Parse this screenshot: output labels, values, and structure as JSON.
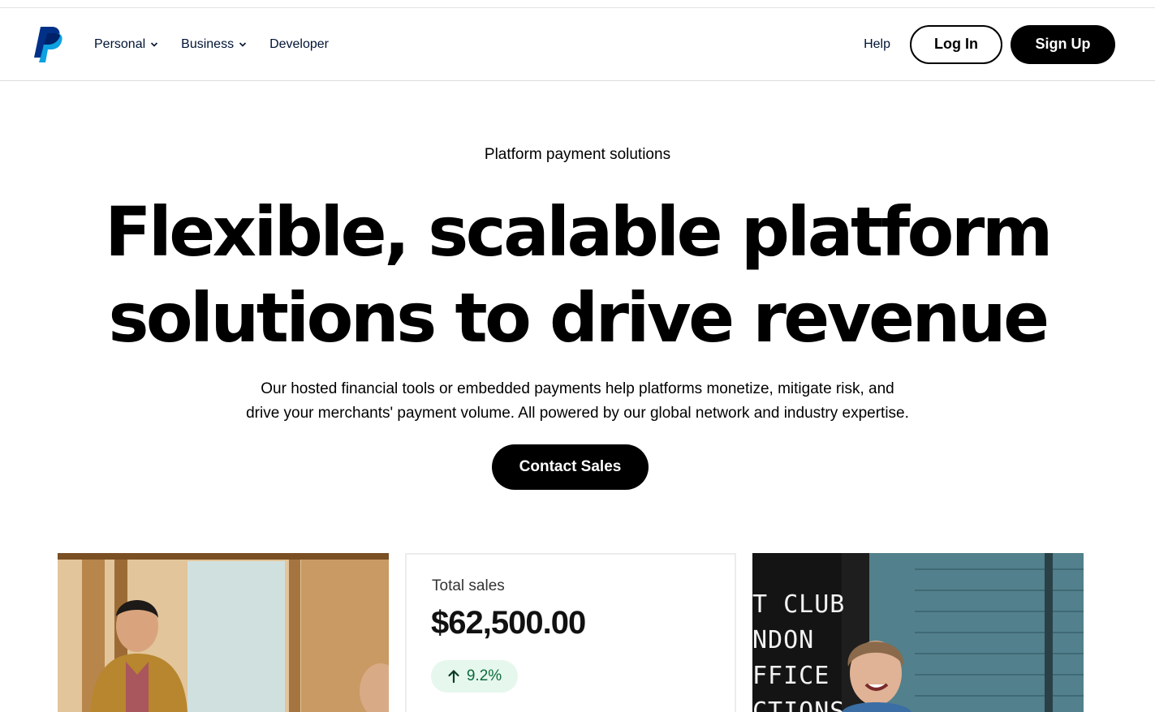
{
  "header": {
    "logo_alt": "PayPal",
    "nav": [
      {
        "label": "Personal",
        "has_dropdown": true
      },
      {
        "label": "Business",
        "has_dropdown": true
      },
      {
        "label": "Developer",
        "has_dropdown": false
      }
    ],
    "help_label": "Help",
    "login_label": "Log In",
    "signup_label": "Sign Up"
  },
  "hero": {
    "eyebrow": "Platform payment solutions",
    "headline_line1": "Flexible, scalable platform",
    "headline_line2": "solutions to drive revenue",
    "sub_line1": "Our hosted financial tools or embedded payments help platforms monetize, mitigate risk, and",
    "sub_line2": "drive your merchants' payment volume. All powered by our global network and industry expertise.",
    "cta_label": "Contact Sales"
  },
  "cards": {
    "sales": {
      "label": "Total sales",
      "value": "$62,500.00",
      "change": "9.2%",
      "change_icon": "arrow-up-icon"
    },
    "photo_left": {
      "icon": "person-at-desk-photo"
    },
    "photo_right": {
      "icon": "smiling-woman-photo",
      "sign_lines": [
        "T CLUB",
        "NDON",
        "FFICE",
        "CTIONS"
      ]
    }
  },
  "colors": {
    "brand_dark_blue": "#003087",
    "brand_light_blue": "#009cde",
    "button_black": "#000000",
    "positive_green": "#0b6b3a",
    "positive_green_bg": "#e6f7ee"
  }
}
